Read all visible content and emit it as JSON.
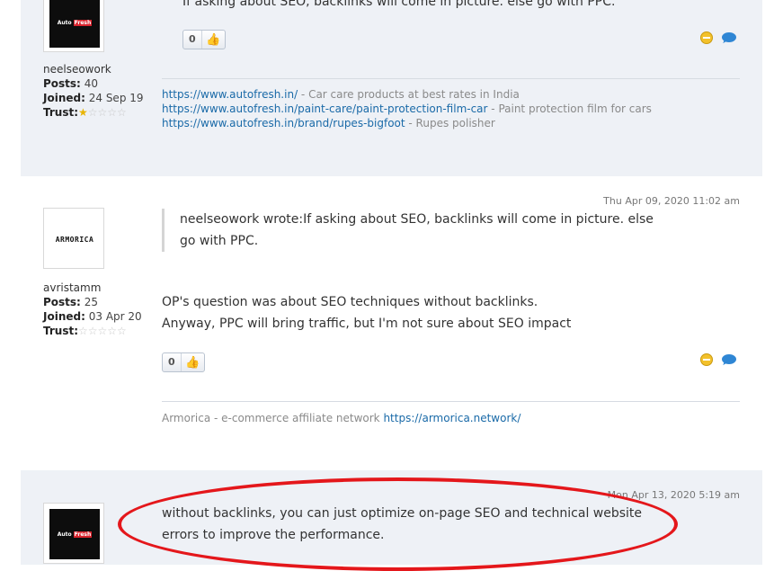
{
  "post1": {
    "top_text": "If asking about SEO, backlinks will come in picture. else go with PPC.",
    "username": "neelseowork",
    "posts_label": "Posts:",
    "posts_value": "40",
    "joined_label": "Joined:",
    "joined_value": "24 Sep 19",
    "trust_label": "Trust:",
    "trust_stars": "★☆☆☆☆",
    "avatar_logo_a": "Auto",
    "avatar_logo_b": "Fresh",
    "like_count": "0",
    "signature": [
      {
        "link": "https://www.autofresh.in/",
        "text": " - Car care products at best rates in India"
      },
      {
        "link": "https://www.autofresh.in/paint-care/paint-protection-film-car",
        "text": " - Paint protection film for cars"
      },
      {
        "link": "https://www.autofresh.in/brand/rupes-bigfoot",
        "text": " - Rupes polisher"
      }
    ]
  },
  "post2": {
    "date": "Thu Apr 09, 2020 11:02 am",
    "quote_line1": "neelseowork wrote:If asking about SEO, backlinks will come in picture. else",
    "quote_line2": "go with PPC.",
    "body_line1": "OP's question was about SEO techniques without backlinks.",
    "body_line2": "Anyway, PPC will bring traffic, but I'm not sure about SEO impact",
    "username": "avristamm",
    "posts_label": "Posts:",
    "posts_value": "25",
    "joined_label": "Joined:",
    "joined_value": "03 Apr 20",
    "trust_label": "Trust:",
    "trust_stars": "☆☆☆☆☆",
    "avatar_logo": "ARMORICA",
    "like_count": "0",
    "signature_text": "Armorica - e-commerce affiliate network ",
    "signature_link": "https://armorica.network/"
  },
  "post3": {
    "date": "Mon Apr 13, 2020 5:19 am",
    "body_line1": "without backlinks, you can just optimize on-page SEO and technical website",
    "body_line2": "errors to improve the performance.",
    "avatar_logo_a": "Auto",
    "avatar_logo_b": "Fresh"
  },
  "icons": {
    "like": "thumbs-up-icon",
    "minus": "minus-circle-icon",
    "reply": "speech-bubble-icon"
  },
  "colors": {
    "link": "#1a6aa8",
    "alt_background": "#eef1f6",
    "annotation": "#e4171b"
  }
}
